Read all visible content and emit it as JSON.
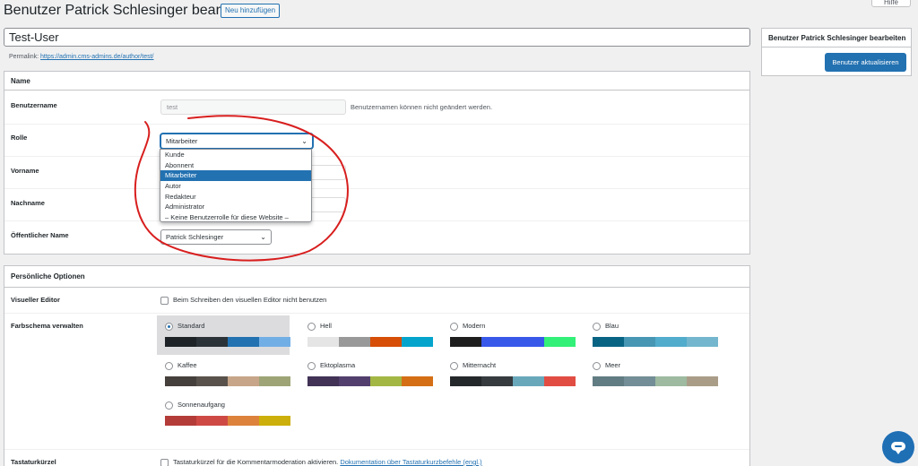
{
  "header": {
    "title": "Benutzer Patrick Schlesinger bearbeiten",
    "add_new_label": "Neu hinzufügen",
    "help_label": "Hilfe"
  },
  "post": {
    "title": "Test-User",
    "permalink_label": "Permalink:",
    "permalink_url": "https://admin.cms-admins.de/author/test/"
  },
  "name_panel": {
    "heading": "Name",
    "username_label": "Benutzername",
    "username_value": "test",
    "username_note": "Benutzernamen können nicht geändert werden.",
    "role_label": "Rolle",
    "role_value": "Mitarbeiter",
    "firstname_label": "Vorname",
    "lastname_label": "Nachname",
    "public_name_label": "Öffentlicher Name",
    "public_name_value": "Patrick Schlesinger"
  },
  "role_options": [
    {
      "label": "Kunde"
    },
    {
      "label": "Abonnent"
    },
    {
      "label": "Mitarbeiter"
    },
    {
      "label": "Autor"
    },
    {
      "label": "Redakteur"
    },
    {
      "label": "Administrator"
    },
    {
      "label": "– Keine Benutzerrolle für diese Website –"
    }
  ],
  "role_selected_index": 2,
  "sidebar": {
    "heading": "Benutzer Patrick Schlesinger bearbeiten",
    "update_label": "Benutzer aktualisieren"
  },
  "personal": {
    "heading": "Persönliche Optionen",
    "visual_editor_label": "Visueller Editor",
    "visual_editor_text": "Beim Schreiben den visuellen Editor nicht benutzen",
    "color_scheme_label": "Farbschema verwalten",
    "shortcuts_label": "Tastaturkürzel",
    "shortcuts_text": "Tastaturkürzel für die Kommentarmoderation aktivieren.",
    "shortcuts_link": "Dokumentation über Tastaturkurzbefehle (engl.)"
  },
  "color_schemes": [
    {
      "name": "Standard",
      "active": true,
      "colors": [
        "#1d2327",
        "#2c3338",
        "#2271b1",
        "#72aee6"
      ]
    },
    {
      "name": "Hell",
      "active": false,
      "colors": [
        "#e5e5e5",
        "#999999",
        "#d64e07",
        "#04a4cc"
      ]
    },
    {
      "name": "Modern",
      "active": false,
      "colors": [
        "#1e1e1e",
        "#3858e9",
        "#3858e9",
        "#33f078"
      ]
    },
    {
      "name": "Blau",
      "active": false,
      "colors": [
        "#096484",
        "#4796b3",
        "#52accc",
        "#74b6ce"
      ]
    },
    {
      "name": "Kaffee",
      "active": false,
      "colors": [
        "#46403c",
        "#59524c",
        "#c7a589",
        "#9ea476"
      ]
    },
    {
      "name": "Ektoplasma",
      "active": false,
      "colors": [
        "#413256",
        "#523f6d",
        "#a3b745",
        "#d46f15"
      ]
    },
    {
      "name": "Mitternacht",
      "active": false,
      "colors": [
        "#25282b",
        "#363b3f",
        "#69a8bb",
        "#e14d43"
      ]
    },
    {
      "name": "Meer",
      "active": false,
      "colors": [
        "#627c83",
        "#738e96",
        "#9ebaa0",
        "#aa9d88"
      ]
    },
    {
      "name": "Sonnenaufgang",
      "active": false,
      "colors": [
        "#b43c38",
        "#cf4944",
        "#dd823b",
        "#ccaf0b"
      ]
    }
  ],
  "colors": {
    "accent": "#2271b1",
    "annotation": "#d81e1e"
  }
}
